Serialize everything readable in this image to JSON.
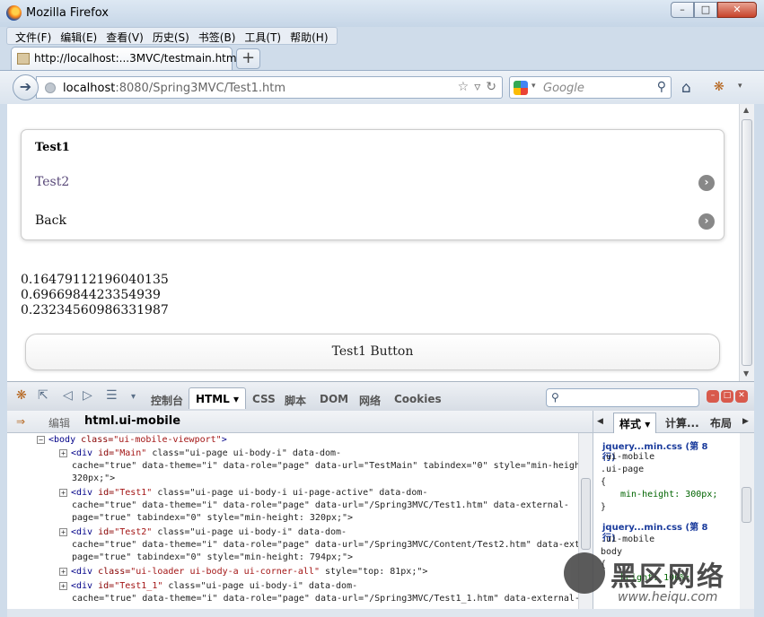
{
  "window": {
    "title": "Mozilla Firefox"
  },
  "menu": [
    "文件(F)",
    "编辑(E)",
    "查看(V)",
    "历史(S)",
    "书签(B)",
    "工具(T)",
    "帮助(H)"
  ],
  "tab": {
    "title": "http://localhost:...3MVC/testmain.htm",
    "new_tab": "+"
  },
  "navbar": {
    "url_host": "localhost",
    "url_rest": ":8080/Spring3MVC/Test1.htm",
    "search_placeholder": "Google"
  },
  "page": {
    "list_header": "Test1",
    "list_items": [
      {
        "label": "Test2"
      },
      {
        "label": "Back"
      }
    ],
    "numbers": [
      "0.16479112196040135",
      "0.6966984423354939",
      "0.23234560986331987"
    ],
    "button_label": "Test1 Button"
  },
  "firebug": {
    "tabs": [
      "控制台",
      "HTML",
      "CSS",
      "脚本",
      "DOM",
      "网络",
      "Cookies"
    ],
    "edit_label": "编辑",
    "breadcrumb": "html.ui-mobile",
    "side_tabs": [
      "样式",
      "计算...",
      "布局"
    ],
    "html_lines": [
      {
        "t1": "<body",
        "a": " class=",
        "v": "\"ui-mobile-viewport\"",
        "t2": ">"
      },
      {
        "t1": "<div",
        "a": " id=",
        "v": "\"Main\"",
        "rest": " class=\"ui-page ui-body-i\" data-dom-"
      },
      {
        "text": "cache=\"true\" data-theme=\"i\" data-role=\"page\" data-url=\"TestMain\" tabindex=\"0\" style=\"min-height:"
      },
      {
        "text": "320px;\">"
      },
      {
        "t1": "<div",
        "a": " id=",
        "v": "\"Test1\"",
        "rest": " class=\"ui-page ui-body-i ui-page-active\" data-dom-"
      },
      {
        "text": "cache=\"true\" data-theme=\"i\" data-role=\"page\" data-url=\"/Spring3MVC/Test1.htm\" data-external-"
      },
      {
        "text": "page=\"true\" tabindex=\"0\" style=\"min-height: 320px;\">"
      },
      {
        "t1": "<div",
        "a": " id=",
        "v": "\"Test2\"",
        "rest": " class=\"ui-page ui-body-i\" data-dom-"
      },
      {
        "text": "cache=\"true\" data-theme=\"i\" data-role=\"page\" data-url=\"/Spring3MVC/Content/Test2.htm\" data-external-"
      },
      {
        "text": "page=\"true\" tabindex=\"0\" style=\"min-height: 794px;\">"
      },
      {
        "t1": "<div",
        "a": " class=",
        "v": "\"ui-loader ui-body-a ui-corner-all\"",
        "rest": " style=\"top: 81px;\">"
      },
      {
        "t1": "<div",
        "a": " id=",
        "v": "\"Test1_1\"",
        "rest": " class=\"ui-page ui-body-i\" data-dom-"
      },
      {
        "text": "cache=\"true\" data-theme=\"i\" data-role=\"page\" data-url=\"/Spring3MVC/Test1_1.htm\" data-external-"
      }
    ],
    "styles": [
      {
        "source": "jquery...min.css (第 8",
        "source2": "行)",
        "lines": [
          ".ui-mobile",
          ".ui-page",
          "{",
          "min-height: 300px;",
          "}"
        ]
      },
      {
        "source": "jquery...min.css (第 8",
        "source2": "行)",
        "lines": [
          ".ui-mobile",
          "body",
          "{",
          "height: 100%;"
        ]
      }
    ]
  },
  "watermark": {
    "text": "黑区网络",
    "url": "www.heiqu.com"
  }
}
